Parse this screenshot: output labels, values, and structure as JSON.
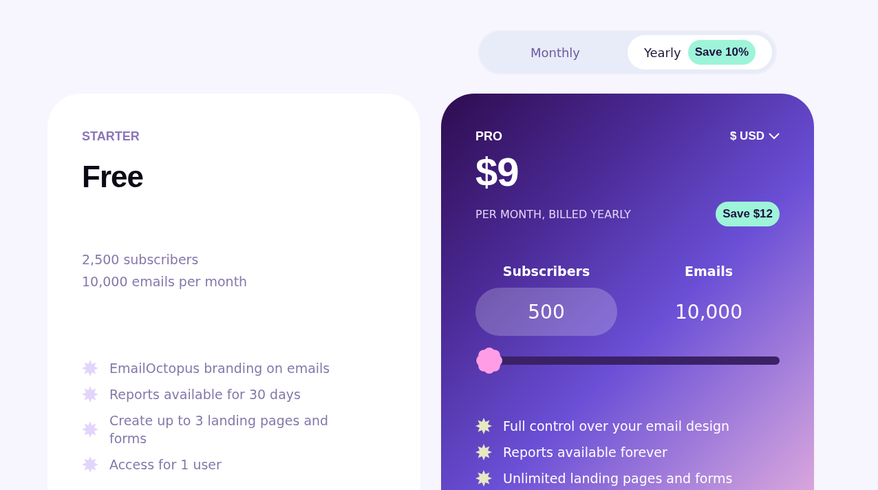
{
  "billing_toggle": {
    "options": [
      {
        "label": "Monthly",
        "selected": false
      },
      {
        "label": "Yearly",
        "selected": true,
        "badge": "Save 10%"
      }
    ]
  },
  "starter": {
    "tier": "STARTER",
    "price": "Free",
    "limits": [
      "2,500 subscribers",
      "10,000 emails per month"
    ],
    "features": [
      "EmailOctopus branding on emails",
      "Reports available for 30 days",
      "Create up to 3 landing pages and forms",
      "Access for 1 user"
    ]
  },
  "pro": {
    "tier": "PRO",
    "currency": "$ USD",
    "price": "$9",
    "billing_note": "PER MONTH, BILLED YEARLY",
    "savings_badge": "Save $12",
    "subscribers": {
      "label": "Subscribers",
      "value": "500"
    },
    "emails": {
      "label": "Emails",
      "value": "10,000"
    },
    "slider": {
      "level": 0
    },
    "features": [
      "Full control over your email design",
      "Reports available forever",
      "Unlimited landing pages and forms"
    ]
  }
}
